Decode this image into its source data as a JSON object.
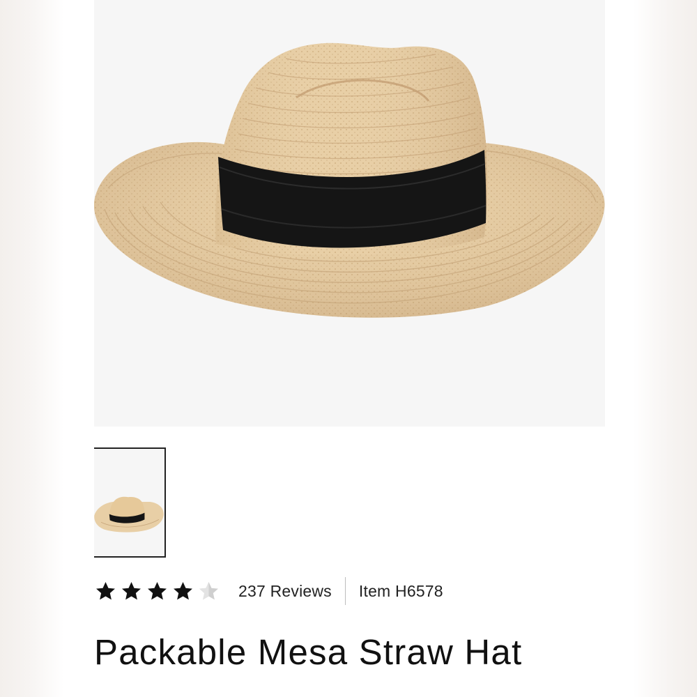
{
  "product": {
    "title": "Packable Mesa Straw Hat",
    "rating": 4.5,
    "rating_max": 5,
    "reviews_label": "237 Reviews",
    "item_label": "Item H6578"
  },
  "gallery": {
    "main_image": "straw-fedora-hat",
    "thumbnails": [
      {
        "image": "straw-fedora-hat",
        "selected": true
      }
    ]
  },
  "colors": {
    "straw": "#e8cfa6",
    "band": "#151515",
    "star_filled": "#111111",
    "star_empty": "#cfcfcf",
    "image_bg": "#f6f6f6"
  }
}
